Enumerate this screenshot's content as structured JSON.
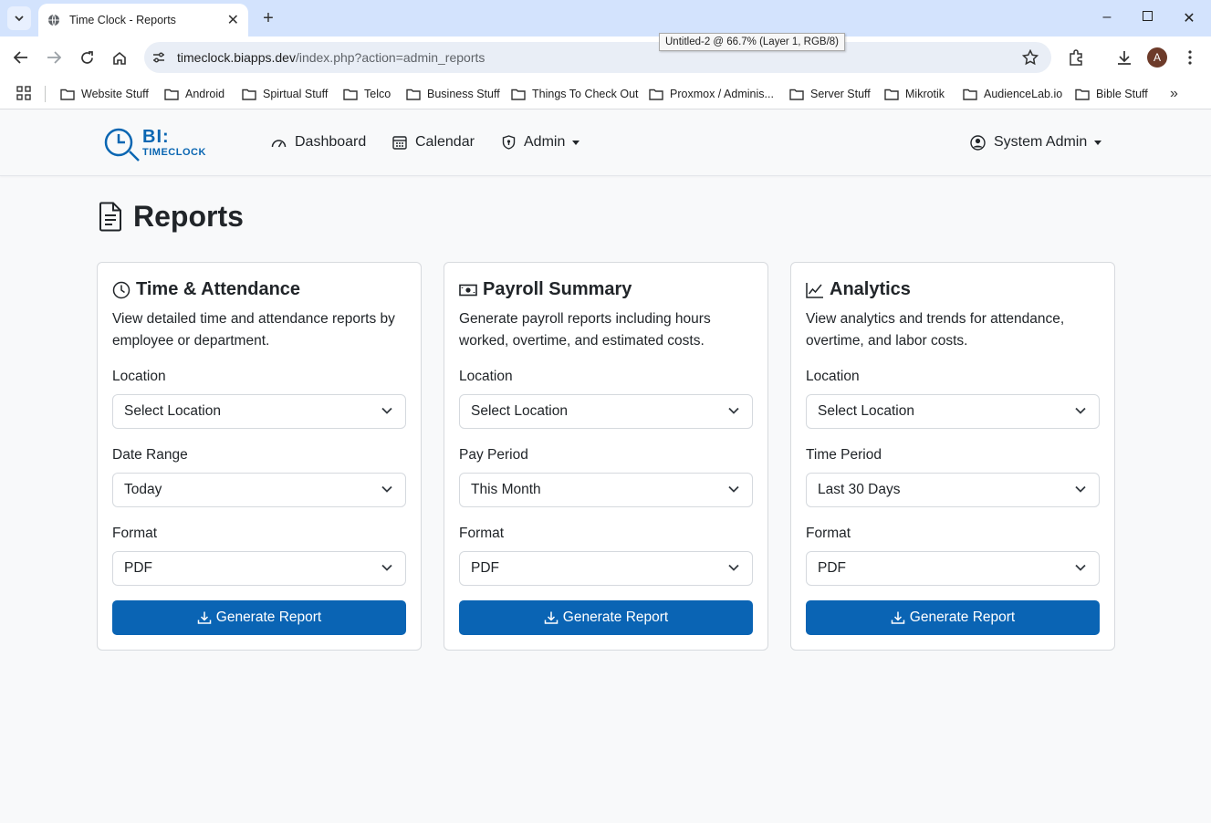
{
  "browser": {
    "tab_title": "Time Clock - Reports",
    "url_host": "timeclock.biapps.dev",
    "url_path": "/index.php?action=admin_reports",
    "tooltip": "Untitled-2 @ 66.7% (Layer 1, RGB/8)",
    "profile_initial": "A",
    "bookmarks": [
      "Website Stuff",
      "Android",
      "Spirtual Stuff",
      "Telco",
      "Business Stuff",
      "Things To Check Out",
      "Proxmox / Adminis...",
      "Server Stuff",
      "Mikrotik",
      "AudienceLab.io",
      "Bible Stuff"
    ]
  },
  "app": {
    "logo_bi": "BI:",
    "logo_timeclock": "TIMECLOCK",
    "nav": {
      "dashboard": "Dashboard",
      "calendar": "Calendar",
      "admin": "Admin",
      "user": "System Admin"
    },
    "page_title": "Reports"
  },
  "cards": [
    {
      "title": "Time & Attendance",
      "description": "View detailed time and attendance reports by employee or department.",
      "field1_label": "Location",
      "field1_value": "Select Location",
      "field2_label": "Date Range",
      "field2_value": "Today",
      "field3_label": "Format",
      "field3_value": "PDF",
      "button": "Generate Report"
    },
    {
      "title": "Payroll Summary",
      "description": "Generate payroll reports including hours worked, overtime, and estimated costs.",
      "field1_label": "Location",
      "field1_value": "Select Location",
      "field2_label": "Pay Period",
      "field2_value": "This Month",
      "field3_label": "Format",
      "field3_value": "PDF",
      "button": "Generate Report"
    },
    {
      "title": "Analytics",
      "description": "View analytics and trends for attendance, overtime, and labor costs.",
      "field1_label": "Location",
      "field1_value": "Select Location",
      "field2_label": "Time Period",
      "field2_value": "Last 30 Days",
      "field3_label": "Format",
      "field3_value": "PDF",
      "button": "Generate Report"
    }
  ],
  "colors": {
    "primary_button": "#0a64b4",
    "logo_blue": "#0a66b2",
    "tabstrip": "#d3e3fd"
  }
}
